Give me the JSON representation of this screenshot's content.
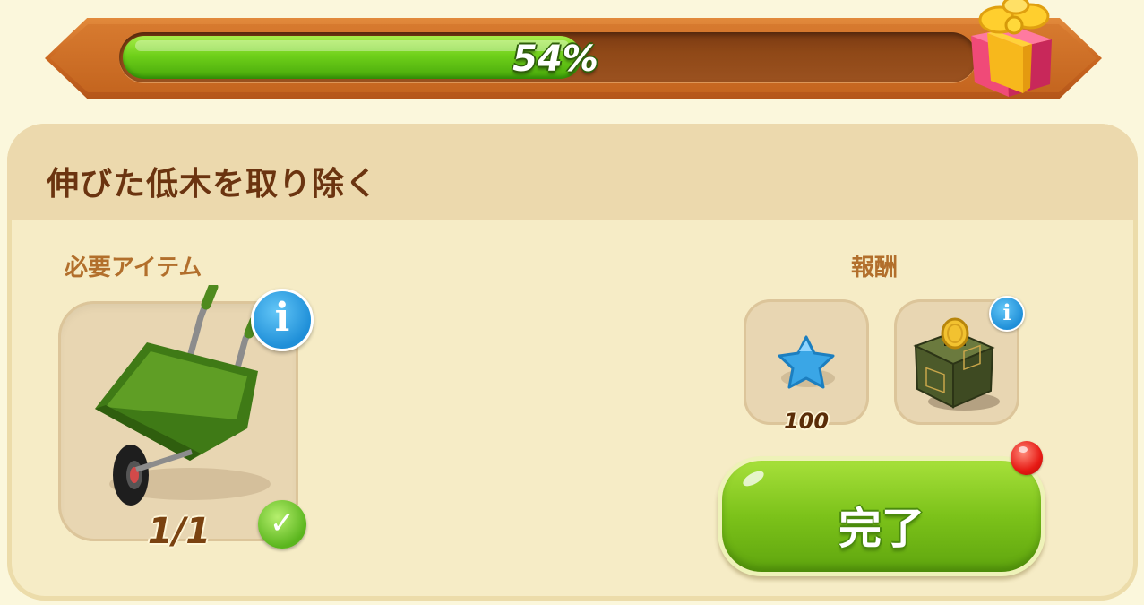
{
  "progress": {
    "percent": 54,
    "label": "54%",
    "fill_color": "#6fd01a"
  },
  "reward_gift_icon": "gift-box-icon",
  "task": {
    "title": "伸びた低木を取り除く"
  },
  "required": {
    "label": "必要アイテム",
    "item_icon": "wheelbarrow-icon",
    "count": "1/1",
    "complete_icon": "check-icon"
  },
  "rewards": {
    "label": "報酬",
    "items": [
      {
        "icon": "blue-star-icon",
        "amount": "100"
      },
      {
        "icon": "coin-box-icon"
      }
    ]
  },
  "complete_button": {
    "label": "完了",
    "color": "#7cc21a"
  }
}
